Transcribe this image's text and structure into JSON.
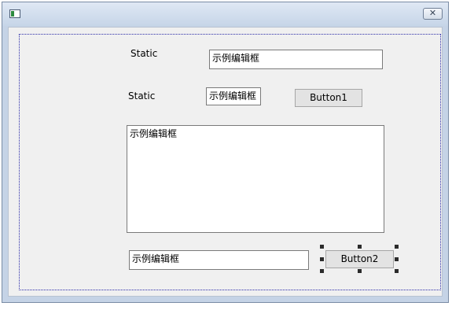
{
  "window": {
    "close_glyph": "✕",
    "icons": {
      "app": "dialog-window-icon",
      "close": "close-icon"
    }
  },
  "dialog": {
    "static1": "Static",
    "edit1": "示例编辑框",
    "static2": "Static",
    "edit2": "示例编辑框",
    "button1": "Button1",
    "edit_multiline": "示例编辑框",
    "edit3": "示例编辑框",
    "button2": "Button2"
  },
  "selection": {
    "selected_control": "Button2"
  },
  "colors": {
    "title_bar": "#c6d5e8",
    "dialog_background": "#f0f0f0",
    "guide_border": "#2a2aa8",
    "button_face": "#e3e3e3"
  }
}
